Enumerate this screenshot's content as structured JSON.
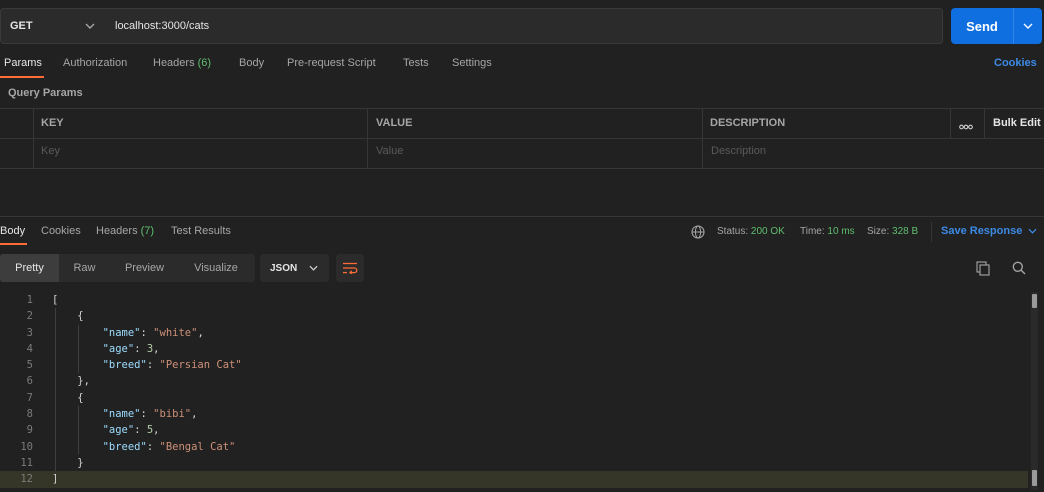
{
  "request": {
    "method": "GET",
    "url": "localhost:3000/cats",
    "send_label": "Send"
  },
  "request_tabs": {
    "params": "Params",
    "authorization": "Authorization",
    "headers": "Headers",
    "headers_count": "(6)",
    "body": "Body",
    "prerequest": "Pre-request Script",
    "tests": "Tests",
    "settings": "Settings",
    "cookies": "Cookies"
  },
  "query_params": {
    "section_title": "Query Params",
    "columns": {
      "key": "KEY",
      "value": "VALUE",
      "description": "DESCRIPTION"
    },
    "more": "ooo",
    "bulk_edit": "Bulk Edit",
    "placeholders": {
      "key": "Key",
      "value": "Value",
      "description": "Description"
    }
  },
  "response_tabs": {
    "body": "Body",
    "cookies": "Cookies",
    "headers": "Headers",
    "headers_count": "(7)",
    "test_results": "Test Results"
  },
  "response_meta": {
    "status_label": "Status:",
    "status_value": "200 OK",
    "time_label": "Time:",
    "time_value": "10 ms",
    "size_label": "Size:",
    "size_value": "328 B",
    "save_response": "Save Response"
  },
  "format_bar": {
    "pretty": "Pretty",
    "raw": "Raw",
    "preview": "Preview",
    "visualize": "Visualize",
    "language": "JSON"
  },
  "code_lines": [
    {
      "num": "1",
      "text": "["
    },
    {
      "num": "2",
      "text": "    {"
    },
    {
      "num": "3",
      "key": "\"name\"",
      "val": "\"white\"",
      "type": "s",
      "indent": "        ",
      "comma": ","
    },
    {
      "num": "4",
      "key": "\"age\"",
      "val": "3",
      "type": "n",
      "indent": "        ",
      "comma": ","
    },
    {
      "num": "5",
      "key": "\"breed\"",
      "val": "\"Persian Cat\"",
      "type": "s",
      "indent": "        ",
      "comma": ""
    },
    {
      "num": "6",
      "text": "    },"
    },
    {
      "num": "7",
      "text": "    {"
    },
    {
      "num": "8",
      "key": "\"name\"",
      "val": "\"bibi\"",
      "type": "s",
      "indent": "        ",
      "comma": ","
    },
    {
      "num": "9",
      "key": "\"age\"",
      "val": "5",
      "type": "n",
      "indent": "        ",
      "comma": ","
    },
    {
      "num": "10",
      "key": "\"breed\"",
      "val": "\"Bengal Cat\"",
      "type": "s",
      "indent": "        ",
      "comma": ""
    },
    {
      "num": "11",
      "text": "    }"
    },
    {
      "num": "12",
      "text": "]"
    }
  ],
  "colors": {
    "accent_orange": "#ff6c37",
    "primary_blue": "#0f6fe0",
    "success_green": "#5fbf6e"
  }
}
